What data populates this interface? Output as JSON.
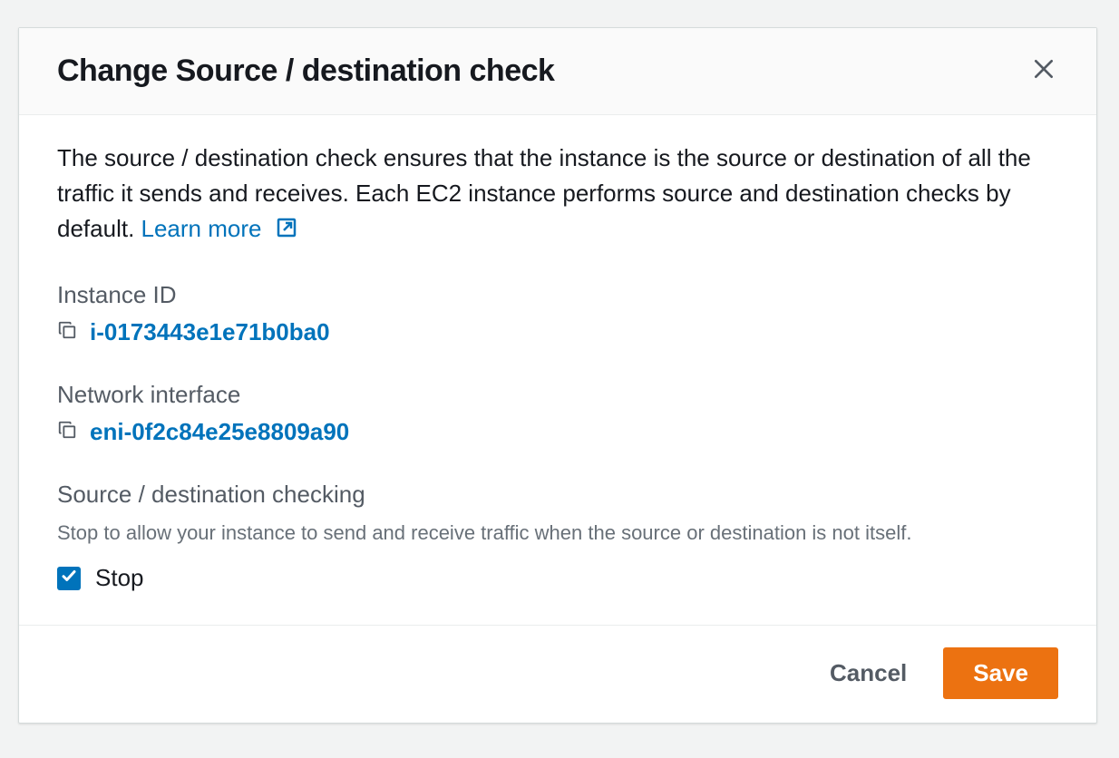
{
  "modal": {
    "title": "Change Source / destination check",
    "description_text": "The source / destination check ensures that the instance is the source or destination of all the traffic it sends and receives. Each EC2 instance performs source and destination checks by default. ",
    "learn_more_label": "Learn more",
    "fields": {
      "instance_id": {
        "label": "Instance ID",
        "value": "i-0173443e1e71b0ba0"
      },
      "network_interface": {
        "label": "Network interface",
        "value": "eni-0f2c84e25e8809a90"
      },
      "src_dest_checking": {
        "label": "Source / destination checking",
        "sub": "Stop to allow your instance to send and receive traffic when the source or destination is not itself.",
        "checkbox_label": "Stop",
        "checked": true
      }
    },
    "footer": {
      "cancel": "Cancel",
      "save": "Save"
    }
  }
}
